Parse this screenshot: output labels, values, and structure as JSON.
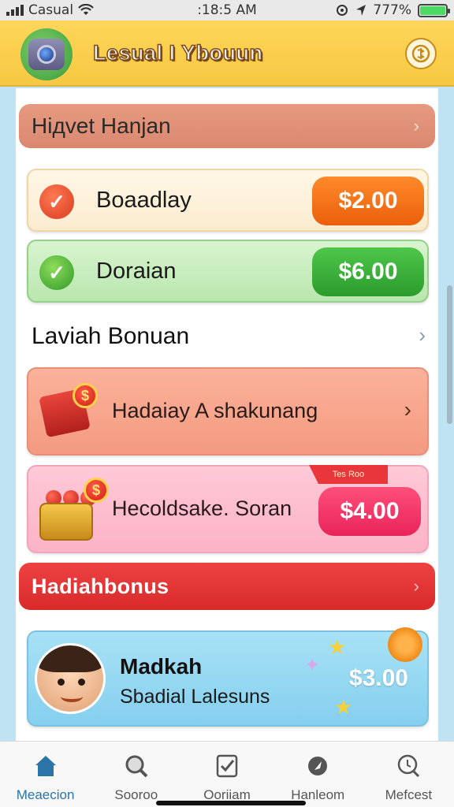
{
  "status_bar": {
    "carrier": "Casual",
    "time": ":18:5 AM",
    "battery": "777%",
    "battery_level": 1.0
  },
  "header": {
    "app_title": "Lesual I Ybouun"
  },
  "sections": {
    "first": "Hiдvet Hanjan",
    "second": "Laviah Bonuan",
    "third": "Hadiahbonus"
  },
  "cards": [
    {
      "label": "Boaadlay",
      "price": "$2.00",
      "accent": "#ea5f0b"
    },
    {
      "label": "Doraian",
      "price": "$6.00",
      "accent": "#2a9c2c"
    },
    {
      "label": "Hadaiay A shakunang"
    },
    {
      "label": "Hecoldsake. Soran",
      "badge": "Tes Roo",
      "price": "$4.00",
      "accent": "#e8245a"
    },
    {
      "title": "Madkah",
      "subtitle": "Sbadial Lalesuns",
      "price": "$3.00"
    }
  ],
  "bottom_nav": [
    {
      "label": "Meaecion",
      "icon": "home-icon",
      "active": true
    },
    {
      "label": "Sooroo",
      "icon": "search-icon"
    },
    {
      "label": "Ooriiam",
      "icon": "checklist-icon"
    },
    {
      "label": "Hanleom",
      "icon": "rocket-icon"
    },
    {
      "label": "Mefcest",
      "icon": "chat-search-icon"
    }
  ]
}
